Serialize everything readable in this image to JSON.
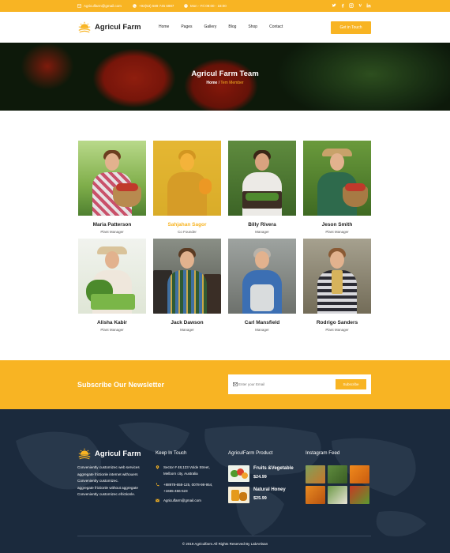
{
  "topbar": {
    "email": "Agriculfarm@gmail.com",
    "phone": "+92(53) 589 745 6987",
    "hours": "Mon - Fri 09:00 - 18:00",
    "social_icons": [
      "twitter-icon",
      "facebook-icon",
      "instagram-icon",
      "vimeo-icon",
      "linkedin-icon"
    ]
  },
  "header": {
    "logo_text": "Agricul Farm",
    "nav": [
      "Home",
      "Pages",
      "Gallery",
      "Blog",
      "Shop",
      "Contact"
    ],
    "cta_label": "Get in Touch"
  },
  "hero": {
    "title": "Agricul Farm Team",
    "breadcrumb_home": "Home",
    "breadcrumb_sep": "/",
    "breadcrumb_current": "Tem Member"
  },
  "team": [
    {
      "name": "Maria Patterson",
      "role": "Plant Manager"
    },
    {
      "name": "Sahjahan Sagor",
      "role": "Co Founder"
    },
    {
      "name": "Billy Rivera",
      "role": "Manager"
    },
    {
      "name": "Jeson Smith",
      "role": "Plant Manager"
    },
    {
      "name": "Alisha Kabir",
      "role": "Plant Manager"
    },
    {
      "name": "Jack Dawson",
      "role": "Manager"
    },
    {
      "name": "Carl Mansfield",
      "role": "Manager"
    },
    {
      "name": "Rodrigo Sanders",
      "role": "Plant Manager"
    }
  ],
  "newsletter": {
    "title": "Subscribe Our Newsletter",
    "placeholder": "Enter your Email",
    "button": "Subscribe"
  },
  "footer": {
    "logo_text": "Agricul Farm",
    "about_lines": [
      "Conveniently customizec web services",
      "aggregate frictionle internet withouers",
      "Conveniently customizec.",
      "aggregate frictionle without aggregate",
      "Conveniently customizec efrictionle."
    ],
    "contact": {
      "heading": "Keep In Touch",
      "address_line1": "Sector # 48,123 Volde Street,",
      "address_line2": "Melborn city, Australia",
      "phone_line1": "+88978-658-125, 0078-98-954,",
      "phone_line2": "+1655-456-523",
      "email": "Agriculfarm@gmail.com"
    },
    "products": {
      "heading": "AgriculFarm Product",
      "items": [
        {
          "name": "Fruits &Vegetable",
          "price": "$24.99"
        },
        {
          "name": "Natural Honey",
          "price": "$25.99"
        }
      ]
    },
    "instagram": {
      "heading": "Instagram Feed"
    },
    "copyright": "© 2019 Agriculfarm.All Rights Reserved By LabArtisan"
  },
  "colors": {
    "accent": "#f8b423",
    "footer_bg": "#1b2a3d"
  }
}
